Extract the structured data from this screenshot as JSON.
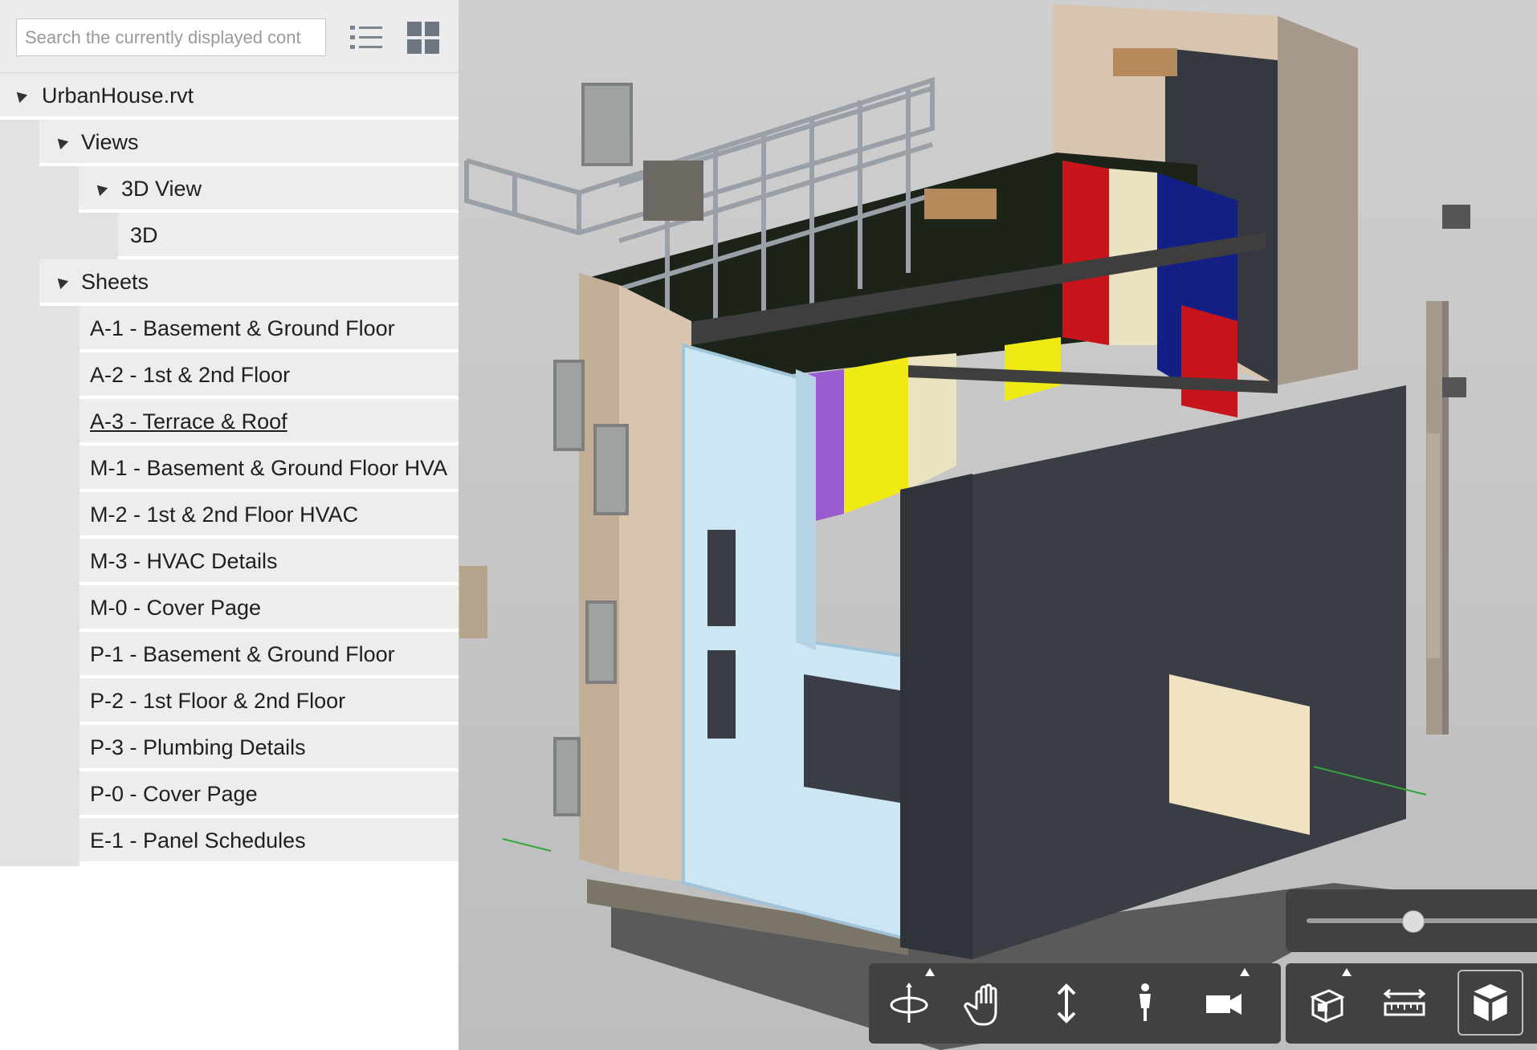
{
  "search": {
    "placeholder": "Search the currently displayed cont"
  },
  "toolbar_icons": {
    "list": "list-icon",
    "grid": "grid-icon"
  },
  "tree": {
    "root": "UrbanHouse.rvt",
    "views": "Views",
    "view_3d": "3D View",
    "view_3d_item": "3D",
    "sheets": "Sheets",
    "sheet_items": [
      "A-1 - Basement & Ground Floor",
      "A-2 - 1st & 2nd Floor",
      "A-3 - Terrace & Roof",
      "M-1 - Basement & Ground Floor HVA",
      "M-2 - 1st & 2nd Floor HVAC",
      "M-3 - HVAC Details",
      "M-0 - Cover Page",
      "P-1 - Basement & Ground Floor",
      "P-2 - 1st Floor & 2nd Floor",
      "P-3 - Plumbing Details",
      "P-0 - Cover Page",
      "E-1 - Panel Schedules"
    ]
  },
  "viewer_tools": [
    "orbit-icon",
    "pan-icon",
    "zoom-icon",
    "first-person-icon",
    "camera-icon",
    "explode-icon",
    "measure-icon",
    "model-browser-icon"
  ],
  "colors": {
    "accent_red": "#c8141b",
    "accent_blue": "#141f85",
    "accent_yellow": "#f0ea14",
    "accent_purple": "#9b5bd0",
    "wall_dark": "#3a3d44",
    "glass_blue": "#cde6f3"
  }
}
